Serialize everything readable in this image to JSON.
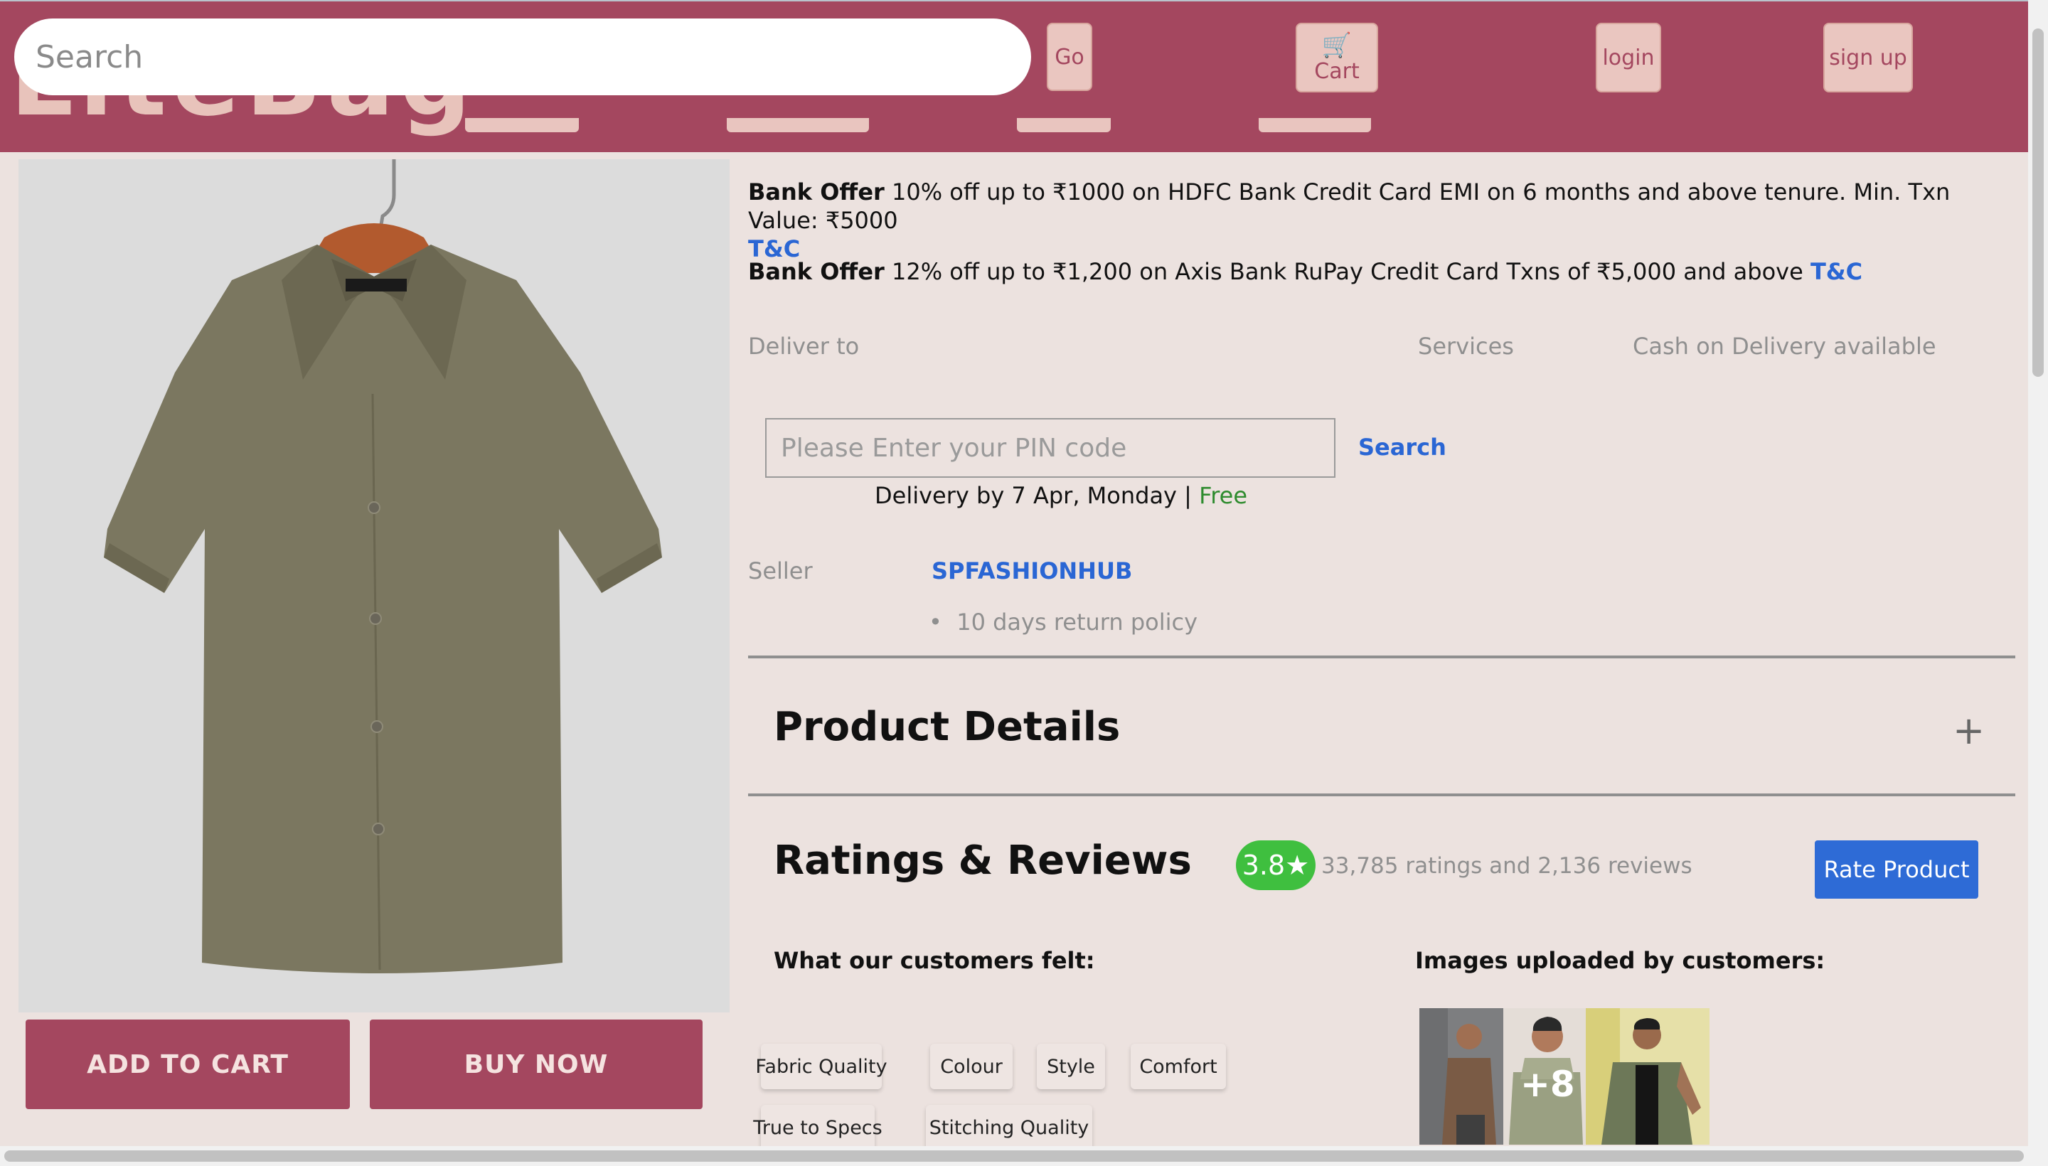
{
  "header": {
    "search_placeholder": "Search",
    "go_label": "Go",
    "cart_label": "Cart",
    "login_label": "login",
    "signup_label": "sign up"
  },
  "product": {
    "add_to_cart_label": "ADD TO CART",
    "buy_now_label": "BUY NOW"
  },
  "offers": [
    {
      "tag": "Bank Offer",
      "text": "10% off up to ₹1000 on HDFC Bank Credit Card EMI on 6 months and above tenure. Min. Txn Value: ₹5000",
      "link": "T&C"
    },
    {
      "tag": "Bank Offer",
      "text": "12% off up to ₹1,200 on Axis Bank RuPay Credit Card Txns of ₹5,000 and above",
      "link": "T&C"
    }
  ],
  "delivery": {
    "deliver_to_label": "Deliver to",
    "services_label": "Services",
    "cod_text": "Cash on Delivery available",
    "pin_placeholder": "Please Enter your PIN code",
    "search_label": "Search",
    "delivery_text": "Delivery by 7 Apr, Monday | ",
    "free_label": "Free"
  },
  "seller": {
    "label": "Seller",
    "name": "SPFASHIONHUB",
    "policy": "10 days return policy"
  },
  "product_details": {
    "title": "Product Details",
    "expand_symbol": "+"
  },
  "ratings": {
    "title": "Ratings & Reviews",
    "score": "3.8",
    "star": "★",
    "summary": "33,785 ratings and 2,136 reviews",
    "rate_button": "Rate Product",
    "customers_felt_label": "What our customers felt:",
    "images_label": "Images uploaded by customers:",
    "chips": [
      "Fabric Quality",
      "Colour",
      "Style",
      "Comfort",
      "True to Specs",
      "Stitching Quality"
    ],
    "more_images": "+8"
  },
  "colors": {
    "brand": "#a4475f",
    "page_bg": "#ece2df",
    "link": "#2a66d4",
    "rating_green": "#3fbf3f",
    "free_green": "#2e8b2e"
  }
}
